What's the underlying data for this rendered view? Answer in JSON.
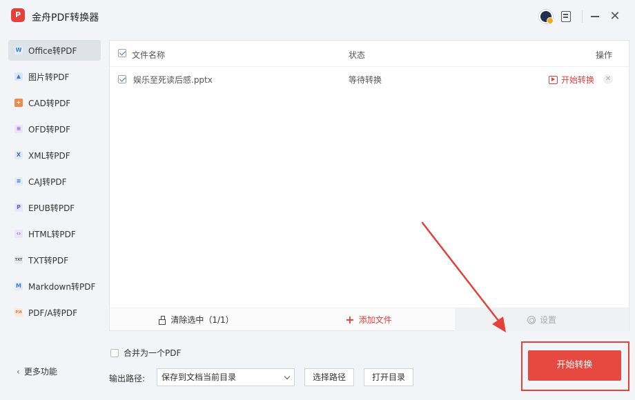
{
  "app": {
    "logo_text": "P",
    "title": "金舟PDF转换器"
  },
  "sidebar": {
    "items": [
      {
        "label": "Office转PDF",
        "icon": "word-icon",
        "glyph": "W",
        "color": "#3a7be0",
        "bg": "#e3ecfb",
        "active": true
      },
      {
        "label": "图片转PDF",
        "icon": "image-icon",
        "glyph": "▲",
        "color": "#3a7be0",
        "bg": "#dbe7fb",
        "active": false
      },
      {
        "label": "CAD转PDF",
        "icon": "cad-icon",
        "glyph": "+",
        "color": "#ffffff",
        "bg": "#f08a4b",
        "active": false
      },
      {
        "label": "OFD转PDF",
        "icon": "ofd-icon",
        "glyph": "≡",
        "color": "#8a63d2",
        "bg": "#ece4fa",
        "active": false
      },
      {
        "label": "XML转PDF",
        "icon": "xml-icon",
        "glyph": "X",
        "color": "#3a6bc9",
        "bg": "#e3ebfa",
        "active": false
      },
      {
        "label": "CAJ转PDF",
        "icon": "caj-icon",
        "glyph": "≡",
        "color": "#3a7be0",
        "bg": "#e3ecfb",
        "active": false
      },
      {
        "label": "EPUB转PDF",
        "icon": "epub-icon",
        "glyph": "P",
        "color": "#5b5bd6",
        "bg": "#e7e7fb",
        "active": false
      },
      {
        "label": "HTML转PDF",
        "icon": "html-icon",
        "glyph": "‹›",
        "color": "#8a63d2",
        "bg": "#ece4fa",
        "active": false
      },
      {
        "label": "TXT转PDF",
        "icon": "txt-icon",
        "glyph": "TXT",
        "color": "#555555",
        "bg": "#e6e8ec",
        "active": false
      },
      {
        "label": "Markdown转PDF",
        "icon": "markdown-icon",
        "glyph": "M",
        "color": "#3a7be0",
        "bg": "#e3ecfb",
        "active": false
      },
      {
        "label": "PDF/A转PDF",
        "icon": "pdfa-icon",
        "glyph": "P/A",
        "color": "#e5703a",
        "bg": "#fde9dc",
        "active": false
      }
    ],
    "more_label": "更多功能"
  },
  "table": {
    "headers": {
      "name": "文件名称",
      "status": "状态",
      "action": "操作"
    },
    "rows": [
      {
        "name": "娱乐至死读后感.pptx",
        "status": "等待转换",
        "action": "开始转换",
        "checked": true
      }
    ]
  },
  "toolbar": {
    "clear_label": "清除选中（1/1）",
    "add_label": "添加文件",
    "settings_label": "设置"
  },
  "options": {
    "merge_label": "合并为一个PDF",
    "output_label": "输出路径:",
    "output_value": "保存到文档当前目录",
    "choose_path_label": "选择路径",
    "open_dir_label": "打开目录"
  },
  "start_button_label": "开始转换",
  "colors": {
    "accent": "#e5403a",
    "primary_blue": "#3a7be0"
  }
}
